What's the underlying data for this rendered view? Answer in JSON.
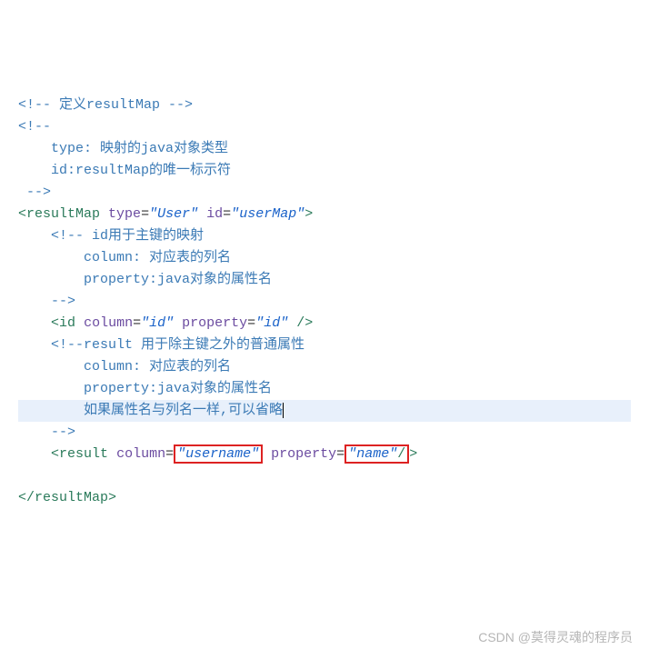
{
  "lines": {
    "l1": "<!-- 定义resultMap -->",
    "l2": "<!--",
    "l3": "    type: 映射的java对象类型",
    "l4": "    id:resultMap的唯一标示符",
    "l5": " -->",
    "tag_open": {
      "name": "resultMap",
      "attr1": "type",
      "val1": "User",
      "attr2": "id",
      "val2": "userMap"
    },
    "c1a": "    <!-- id用于主键的映射",
    "c1b": "        column: 对应表的列名",
    "c1c": "        property:java对象的属性名",
    "c1d": "    -->",
    "id_tag": {
      "name": "id",
      "attr1": "column",
      "val1": "id",
      "attr2": "property",
      "val2": "id"
    },
    "c2a": "    <!--result 用于除主键之外的普通属性",
    "c2b": "        column: 对应表的列名",
    "c2c": "        property:java对象的属性名",
    "c2d": "        如果属性名与列名一样,可以省略",
    "c2e": "    -->",
    "result_tag": {
      "name": "result",
      "attr1": "column",
      "val1": "username",
      "attr2": "property",
      "val2": "name"
    },
    "tag_close": "resultMap"
  },
  "watermark": "CSDN @莫得灵魂的程序员"
}
